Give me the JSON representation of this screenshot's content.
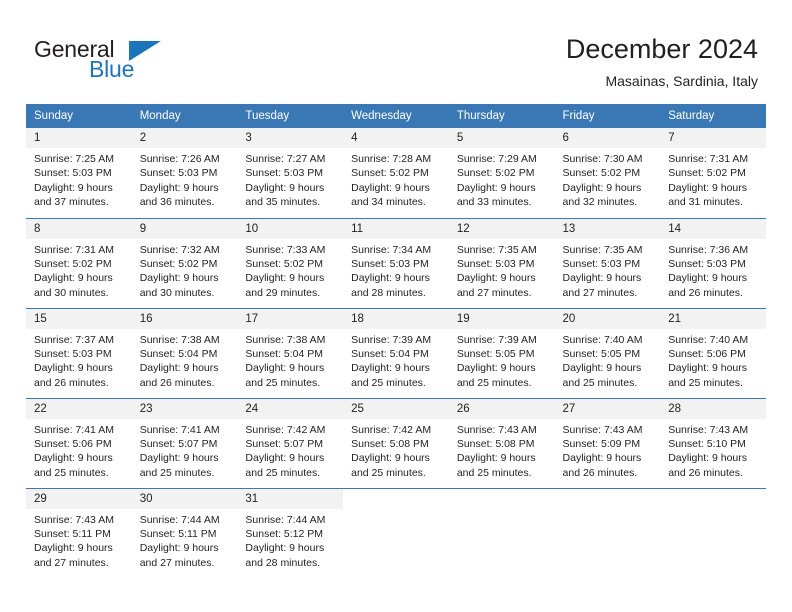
{
  "logo": {
    "word1": "General",
    "word2": "Blue",
    "triangle_color": "#1b75bb"
  },
  "header": {
    "title": "December 2024",
    "subtitle": "Masainas, Sardinia, Italy",
    "header_bg": "#3a78b5",
    "daynum_bg": "#f2f2f2"
  },
  "weekdays": [
    "Sunday",
    "Monday",
    "Tuesday",
    "Wednesday",
    "Thursday",
    "Friday",
    "Saturday"
  ],
  "labels": {
    "sunrise": "Sunrise:",
    "sunset": "Sunset:",
    "daylight": "Daylight:"
  },
  "weeks": [
    [
      {
        "day": "1",
        "sunrise": "Sunrise: 7:25 AM",
        "sunset": "Sunset: 5:03 PM",
        "daylight1": "Daylight: 9 hours",
        "daylight2": "and 37 minutes."
      },
      {
        "day": "2",
        "sunrise": "Sunrise: 7:26 AM",
        "sunset": "Sunset: 5:03 PM",
        "daylight1": "Daylight: 9 hours",
        "daylight2": "and 36 minutes."
      },
      {
        "day": "3",
        "sunrise": "Sunrise: 7:27 AM",
        "sunset": "Sunset: 5:03 PM",
        "daylight1": "Daylight: 9 hours",
        "daylight2": "and 35 minutes."
      },
      {
        "day": "4",
        "sunrise": "Sunrise: 7:28 AM",
        "sunset": "Sunset: 5:02 PM",
        "daylight1": "Daylight: 9 hours",
        "daylight2": "and 34 minutes."
      },
      {
        "day": "5",
        "sunrise": "Sunrise: 7:29 AM",
        "sunset": "Sunset: 5:02 PM",
        "daylight1": "Daylight: 9 hours",
        "daylight2": "and 33 minutes."
      },
      {
        "day": "6",
        "sunrise": "Sunrise: 7:30 AM",
        "sunset": "Sunset: 5:02 PM",
        "daylight1": "Daylight: 9 hours",
        "daylight2": "and 32 minutes."
      },
      {
        "day": "7",
        "sunrise": "Sunrise: 7:31 AM",
        "sunset": "Sunset: 5:02 PM",
        "daylight1": "Daylight: 9 hours",
        "daylight2": "and 31 minutes."
      }
    ],
    [
      {
        "day": "8",
        "sunrise": "Sunrise: 7:31 AM",
        "sunset": "Sunset: 5:02 PM",
        "daylight1": "Daylight: 9 hours",
        "daylight2": "and 30 minutes."
      },
      {
        "day": "9",
        "sunrise": "Sunrise: 7:32 AM",
        "sunset": "Sunset: 5:02 PM",
        "daylight1": "Daylight: 9 hours",
        "daylight2": "and 30 minutes."
      },
      {
        "day": "10",
        "sunrise": "Sunrise: 7:33 AM",
        "sunset": "Sunset: 5:02 PM",
        "daylight1": "Daylight: 9 hours",
        "daylight2": "and 29 minutes."
      },
      {
        "day": "11",
        "sunrise": "Sunrise: 7:34 AM",
        "sunset": "Sunset: 5:03 PM",
        "daylight1": "Daylight: 9 hours",
        "daylight2": "and 28 minutes."
      },
      {
        "day": "12",
        "sunrise": "Sunrise: 7:35 AM",
        "sunset": "Sunset: 5:03 PM",
        "daylight1": "Daylight: 9 hours",
        "daylight2": "and 27 minutes."
      },
      {
        "day": "13",
        "sunrise": "Sunrise: 7:35 AM",
        "sunset": "Sunset: 5:03 PM",
        "daylight1": "Daylight: 9 hours",
        "daylight2": "and 27 minutes."
      },
      {
        "day": "14",
        "sunrise": "Sunrise: 7:36 AM",
        "sunset": "Sunset: 5:03 PM",
        "daylight1": "Daylight: 9 hours",
        "daylight2": "and 26 minutes."
      }
    ],
    [
      {
        "day": "15",
        "sunrise": "Sunrise: 7:37 AM",
        "sunset": "Sunset: 5:03 PM",
        "daylight1": "Daylight: 9 hours",
        "daylight2": "and 26 minutes."
      },
      {
        "day": "16",
        "sunrise": "Sunrise: 7:38 AM",
        "sunset": "Sunset: 5:04 PM",
        "daylight1": "Daylight: 9 hours",
        "daylight2": "and 26 minutes."
      },
      {
        "day": "17",
        "sunrise": "Sunrise: 7:38 AM",
        "sunset": "Sunset: 5:04 PM",
        "daylight1": "Daylight: 9 hours",
        "daylight2": "and 25 minutes."
      },
      {
        "day": "18",
        "sunrise": "Sunrise: 7:39 AM",
        "sunset": "Sunset: 5:04 PM",
        "daylight1": "Daylight: 9 hours",
        "daylight2": "and 25 minutes."
      },
      {
        "day": "19",
        "sunrise": "Sunrise: 7:39 AM",
        "sunset": "Sunset: 5:05 PM",
        "daylight1": "Daylight: 9 hours",
        "daylight2": "and 25 minutes."
      },
      {
        "day": "20",
        "sunrise": "Sunrise: 7:40 AM",
        "sunset": "Sunset: 5:05 PM",
        "daylight1": "Daylight: 9 hours",
        "daylight2": "and 25 minutes."
      },
      {
        "day": "21",
        "sunrise": "Sunrise: 7:40 AM",
        "sunset": "Sunset: 5:06 PM",
        "daylight1": "Daylight: 9 hours",
        "daylight2": "and 25 minutes."
      }
    ],
    [
      {
        "day": "22",
        "sunrise": "Sunrise: 7:41 AM",
        "sunset": "Sunset: 5:06 PM",
        "daylight1": "Daylight: 9 hours",
        "daylight2": "and 25 minutes."
      },
      {
        "day": "23",
        "sunrise": "Sunrise: 7:41 AM",
        "sunset": "Sunset: 5:07 PM",
        "daylight1": "Daylight: 9 hours",
        "daylight2": "and 25 minutes."
      },
      {
        "day": "24",
        "sunrise": "Sunrise: 7:42 AM",
        "sunset": "Sunset: 5:07 PM",
        "daylight1": "Daylight: 9 hours",
        "daylight2": "and 25 minutes."
      },
      {
        "day": "25",
        "sunrise": "Sunrise: 7:42 AM",
        "sunset": "Sunset: 5:08 PM",
        "daylight1": "Daylight: 9 hours",
        "daylight2": "and 25 minutes."
      },
      {
        "day": "26",
        "sunrise": "Sunrise: 7:43 AM",
        "sunset": "Sunset: 5:08 PM",
        "daylight1": "Daylight: 9 hours",
        "daylight2": "and 25 minutes."
      },
      {
        "day": "27",
        "sunrise": "Sunrise: 7:43 AM",
        "sunset": "Sunset: 5:09 PM",
        "daylight1": "Daylight: 9 hours",
        "daylight2": "and 26 minutes."
      },
      {
        "day": "28",
        "sunrise": "Sunrise: 7:43 AM",
        "sunset": "Sunset: 5:10 PM",
        "daylight1": "Daylight: 9 hours",
        "daylight2": "and 26 minutes."
      }
    ],
    [
      {
        "day": "29",
        "sunrise": "Sunrise: 7:43 AM",
        "sunset": "Sunset: 5:11 PM",
        "daylight1": "Daylight: 9 hours",
        "daylight2": "and 27 minutes."
      },
      {
        "day": "30",
        "sunrise": "Sunrise: 7:44 AM",
        "sunset": "Sunset: 5:11 PM",
        "daylight1": "Daylight: 9 hours",
        "daylight2": "and 27 minutes."
      },
      {
        "day": "31",
        "sunrise": "Sunrise: 7:44 AM",
        "sunset": "Sunset: 5:12 PM",
        "daylight1": "Daylight: 9 hours",
        "daylight2": "and 28 minutes."
      },
      {
        "day": "",
        "sunrise": "",
        "sunset": "",
        "daylight1": "",
        "daylight2": ""
      },
      {
        "day": "",
        "sunrise": "",
        "sunset": "",
        "daylight1": "",
        "daylight2": ""
      },
      {
        "day": "",
        "sunrise": "",
        "sunset": "",
        "daylight1": "",
        "daylight2": ""
      },
      {
        "day": "",
        "sunrise": "",
        "sunset": "",
        "daylight1": "",
        "daylight2": ""
      }
    ]
  ]
}
